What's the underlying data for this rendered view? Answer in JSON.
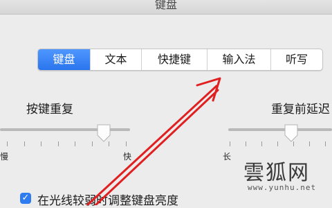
{
  "window": {
    "title": "键盘"
  },
  "tabs": [
    {
      "label": "键盘",
      "selected": true
    },
    {
      "label": "文本"
    },
    {
      "label": "快捷键"
    },
    {
      "label": "输入法"
    },
    {
      "label": "听写"
    }
  ],
  "key_repeat": {
    "label": "按键重复",
    "min_label": "慢",
    "max_label": "快",
    "level": 0.8
  },
  "repeat_delay": {
    "label": "重复前延迟",
    "min_label": "长",
    "level": 0.6
  },
  "brightness_option": {
    "label": "在光线较弱时调整键盘亮度",
    "checked": true
  },
  "watermark": {
    "brand": "雲狐网",
    "url": "www.yunhu.net"
  },
  "colors": {
    "accent": "#2a75ee",
    "arrow": "#e02020"
  }
}
